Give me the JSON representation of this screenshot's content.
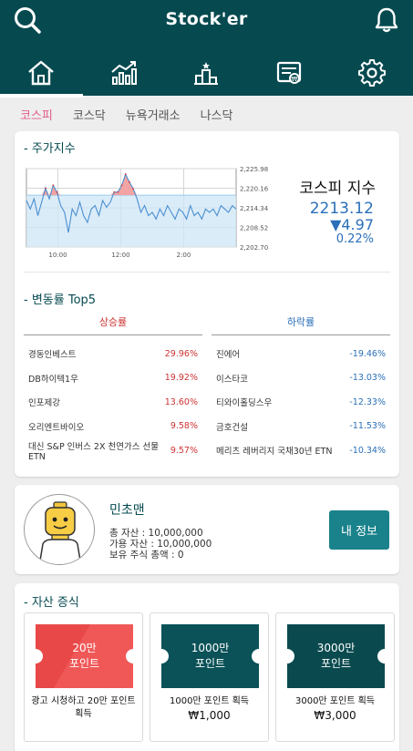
{
  "app": {
    "title": "Stock'er"
  },
  "icons": {
    "search": "search-icon",
    "notifications": "bell-icon"
  },
  "nav": {
    "tabs": [
      {
        "icon": "home-icon",
        "active": true
      },
      {
        "icon": "chart-trend-icon",
        "active": false
      },
      {
        "icon": "ranking-podium-icon",
        "active": false
      },
      {
        "icon": "news-icon",
        "active": false
      },
      {
        "icon": "gear-icon",
        "active": false
      }
    ]
  },
  "market_tabs": [
    "코스피",
    "코스닥",
    "뉴욕거래소",
    "나스닥"
  ],
  "index_section": {
    "title": "- 주가지수",
    "name": "코스피 지수",
    "value": "2213.12",
    "change": "▼4.97",
    "change_pct": "0.22%"
  },
  "chart_data": {
    "type": "line",
    "title": "",
    "x_tick_labels": [
      "10:00",
      "12:00",
      "2:00"
    ],
    "y_tick_labels": [
      "2,225.98",
      "2,220.16",
      "2,214.34",
      "2,208.52",
      "2,202.70"
    ],
    "ylim": [
      2202.7,
      2225.98
    ],
    "reference_value": 2218.09,
    "grid": true,
    "series": [
      {
        "values": [
          2216.5,
          2214,
          2217,
          2212,
          2216,
          2220.2,
          2217,
          2221,
          2219,
          2215,
          2213,
          2207,
          2214,
          2212,
          2216,
          2212,
          2210,
          2214,
          2215,
          2212,
          2216.5,
          2214.5,
          2216,
          2219,
          2219,
          2221,
          2224.3,
          2222,
          2220,
          2217,
          2213,
          2215,
          2212,
          2213,
          2211,
          2214,
          2212,
          2215,
          2213,
          2211,
          2214,
          2213,
          2211,
          2215,
          2212,
          2213,
          2211,
          2214,
          2213,
          2214,
          2212,
          2215,
          2214,
          2213,
          2215,
          2214
        ]
      }
    ]
  },
  "movers": {
    "title": "- 변동률 Top5",
    "up_label": "상승률",
    "down_label": "하락률",
    "up": [
      {
        "name": "경동인베스트",
        "pct": "29.96%"
      },
      {
        "name": "DB하이텍1우",
        "pct": "19.92%"
      },
      {
        "name": "인포제강",
        "pct": "13.60%"
      },
      {
        "name": "오리엔트바이오",
        "pct": "9.58%"
      },
      {
        "name": "대신 S&P 인버스 2X 천연가스 선물 ETN",
        "pct": "9.57%"
      }
    ],
    "down": [
      {
        "name": "진에어",
        "pct": "-19.46%"
      },
      {
        "name": "이스타코",
        "pct": "-13.03%"
      },
      {
        "name": "티와이홀딩스우",
        "pct": "-12.33%"
      },
      {
        "name": "금호건설",
        "pct": "-11.53%"
      },
      {
        "name": "메리츠 레버리지 국채30년 ETN",
        "pct": "-10.34%"
      }
    ]
  },
  "profile": {
    "name": "민초맨",
    "total_assets": "총 자산 : 10,000,000",
    "available_assets": "가용 자산 : 10,000,000",
    "holdings": "보유 주식 총액 : 0",
    "info_button": "내 정보"
  },
  "gift": {
    "title": "- 자산 증식",
    "tickets": [
      {
        "line1": "20만",
        "line2": "포인트",
        "caption": "광고 시청하고 20만 포인트 획득",
        "price": "",
        "color": "#e94848"
      },
      {
        "line1": "1000만",
        "line2": "포인트",
        "caption": "1000만 포인트 획득",
        "price": "₩1,000",
        "color": "#0a5258"
      },
      {
        "line1": "3000만",
        "line2": "포인트",
        "caption": "3000만 포인트 획득",
        "price": "₩3,000",
        "color": "#0a4a4f"
      }
    ]
  }
}
